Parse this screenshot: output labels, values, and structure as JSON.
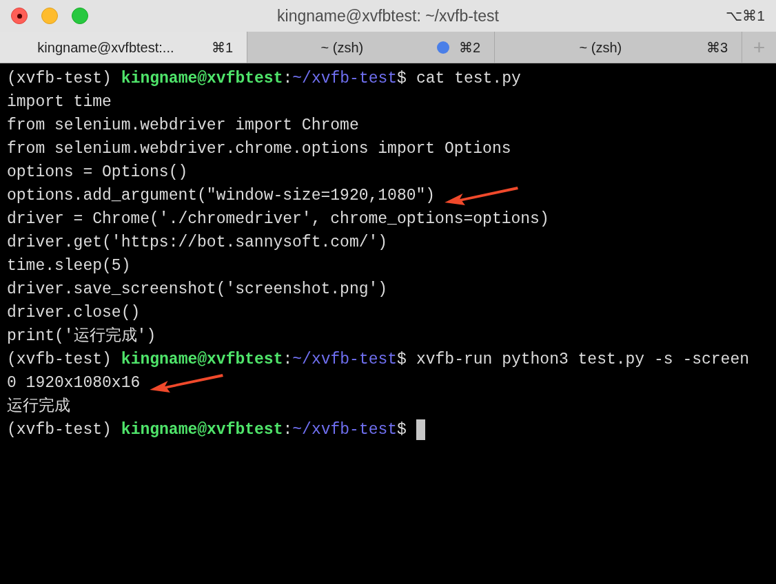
{
  "window": {
    "title": "kingname@xvfbtest: ~/xvfb-test",
    "shortcut": "⌥⌘1"
  },
  "tabs": [
    {
      "label": "kingname@xvfbtest:...",
      "shortcut": "⌘1",
      "selected": true,
      "activity": false
    },
    {
      "label": "~ (zsh)",
      "shortcut": "⌘2",
      "selected": false,
      "activity": true
    },
    {
      "label": "~ (zsh)",
      "shortcut": "⌘3",
      "selected": false,
      "activity": false
    }
  ],
  "new_tab": "+",
  "terminal": [
    {
      "kind": "prompt",
      "env": "(xvfb-test)",
      "user_host": "kingname@xvfbtest",
      "sep": ":",
      "path": "~/xvfb-test",
      "symbol": "$",
      "command": "cat test.py",
      "arrow": false,
      "cursor": false
    },
    {
      "kind": "output",
      "text": "import time",
      "arrow": false
    },
    {
      "kind": "output",
      "text": "from selenium.webdriver import Chrome",
      "arrow": false
    },
    {
      "kind": "output",
      "text": "from selenium.webdriver.chrome.options import Options",
      "arrow": false
    },
    {
      "kind": "output",
      "text": "options = Options()",
      "arrow": false
    },
    {
      "kind": "output",
      "text": "options.add_argument(\"window-size=1920,1080\")",
      "arrow": true
    },
    {
      "kind": "output",
      "text": "driver = Chrome('./chromedriver', chrome_options=options)",
      "arrow": false
    },
    {
      "kind": "output",
      "text": "driver.get('https://bot.sannysoft.com/')",
      "arrow": false
    },
    {
      "kind": "output",
      "text": "time.sleep(5)",
      "arrow": false
    },
    {
      "kind": "output",
      "text": "driver.save_screenshot('screenshot.png')",
      "arrow": false
    },
    {
      "kind": "output",
      "text": "driver.close()",
      "arrow": false
    },
    {
      "kind": "output",
      "text": "print('运行完成')",
      "arrow": false
    },
    {
      "kind": "prompt",
      "env": "(xvfb-test)",
      "user_host": "kingname@xvfbtest",
      "sep": ":",
      "path": "~/xvfb-test",
      "symbol": "$",
      "command": "xvfb-run python3 test.py -s -screen",
      "arrow": false,
      "cursor": false
    },
    {
      "kind": "output",
      "text": "0 1920x1080x16",
      "arrow": true
    },
    {
      "kind": "output",
      "text": "运行完成",
      "arrow": false
    },
    {
      "kind": "prompt",
      "env": "(xvfb-test)",
      "user_host": "kingname@xvfbtest",
      "sep": ":",
      "path": "~/xvfb-test",
      "symbol": "$",
      "arrow": false,
      "cursor": true
    }
  ]
}
